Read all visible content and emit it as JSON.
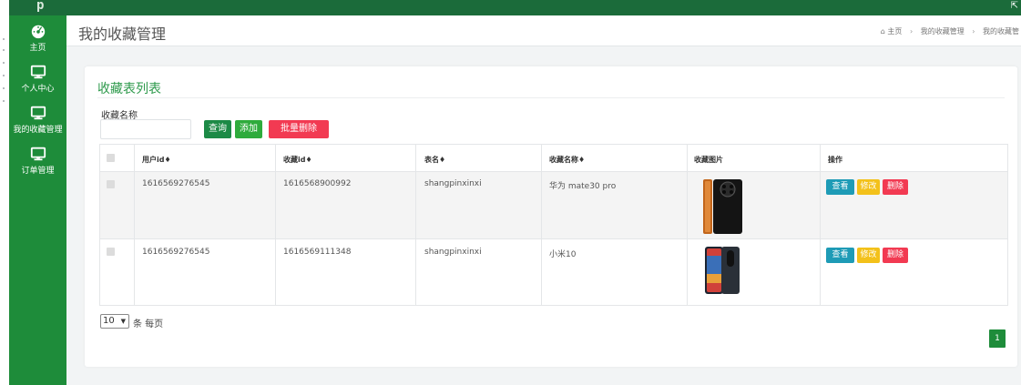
{
  "app": {
    "logo": "p"
  },
  "sidebar": {
    "items": [
      {
        "label": "主页",
        "icon": "dashboard-icon"
      },
      {
        "label": "个人中心",
        "icon": "monitor-icon"
      },
      {
        "label": "我的收藏管理",
        "icon": "monitor-icon"
      },
      {
        "label": "订单管理",
        "icon": "monitor-icon"
      }
    ]
  },
  "header": {
    "title": "我的收藏管理",
    "breadcrumb": [
      "主页",
      "我的收藏管理",
      "我的收藏管"
    ]
  },
  "card": {
    "title": "收藏表列表"
  },
  "search": {
    "label": "收藏名称",
    "value": "",
    "placeholder": "",
    "query_label": "查询",
    "add_label": "添加",
    "batch_delete_label": "批量删除"
  },
  "table": {
    "headers": [
      "用户id♦",
      "收藏id♦",
      "表名♦",
      "收藏名称♦",
      "收藏图片",
      "操作"
    ],
    "rows": [
      {
        "user_id": "1616569276545",
        "fav_id": "1616568900992",
        "table_name": "shangpinxinxi",
        "fav_name": "华为 mate30 pro"
      },
      {
        "user_id": "1616569276545",
        "fav_id": "1616569111348",
        "table_name": "shangpinxinxi",
        "fav_name": "小米10"
      }
    ],
    "actions": {
      "view": "查看",
      "edit": "修改",
      "delete": "删除"
    }
  },
  "pager": {
    "page_size": "10",
    "per_page_label": "条 每页",
    "current_page": "1"
  },
  "colors": {
    "sidebar": "#1e8c3a",
    "topbar": "#1b6b3a",
    "accent": "#2e9a4c",
    "danger": "#f23a52",
    "warning": "#f3c11a",
    "info": "#1e9bb6"
  }
}
